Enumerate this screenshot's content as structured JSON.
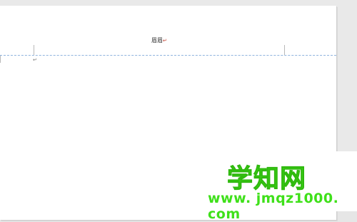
{
  "document": {
    "header_text": "眉眉",
    "header_mark": "↵",
    "body_mark": "↵"
  },
  "watermark": {
    "title": "学知网",
    "url": "www. jmqz1000. com"
  }
}
